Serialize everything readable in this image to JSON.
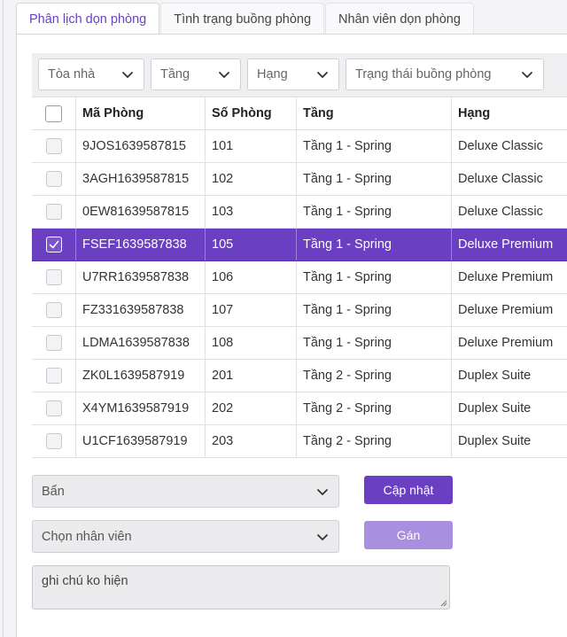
{
  "tabs": [
    {
      "label": "Phân lịch dọn phòng",
      "active": true
    },
    {
      "label": "Tình trạng buồng phòng",
      "active": false
    },
    {
      "label": "Nhân viên dọn phòng",
      "active": false
    }
  ],
  "filters": {
    "building": "Tòa nhà",
    "floor": "Tầng",
    "class": "Hạng",
    "room_status": "Trạng thái buồng phòng"
  },
  "table": {
    "columns": [
      "Mã Phòng",
      "Số Phòng",
      "Tầng",
      "Hạng"
    ],
    "rows": [
      {
        "code": "9JOS1639587815",
        "number": "101",
        "floor": "Tầng 1 - Spring",
        "class": "Deluxe Classic",
        "selected": false
      },
      {
        "code": "3AGH1639587815",
        "number": "102",
        "floor": "Tầng 1 - Spring",
        "class": "Deluxe Classic",
        "selected": false
      },
      {
        "code": "0EW81639587815",
        "number": "103",
        "floor": "Tầng 1 - Spring",
        "class": "Deluxe Classic",
        "selected": false
      },
      {
        "code": "FSEF1639587838",
        "number": "105",
        "floor": "Tầng 1 - Spring",
        "class": "Deluxe Premium",
        "selected": true
      },
      {
        "code": "U7RR1639587838",
        "number": "106",
        "floor": "Tầng 1 - Spring",
        "class": "Deluxe Premium",
        "selected": false
      },
      {
        "code": "FZ331639587838",
        "number": "107",
        "floor": "Tầng 1 - Spring",
        "class": "Deluxe Premium",
        "selected": false
      },
      {
        "code": "LDMA1639587838",
        "number": "108",
        "floor": "Tầng 1 - Spring",
        "class": "Deluxe Premium",
        "selected": false
      },
      {
        "code": "ZK0L1639587919",
        "number": "201",
        "floor": "Tầng 2 - Spring",
        "class": "Duplex Suite",
        "selected": false
      },
      {
        "code": "X4YM1639587919",
        "number": "202",
        "floor": "Tầng 2 - Spring",
        "class": "Duplex Suite",
        "selected": false
      },
      {
        "code": "U1CF1639587919",
        "number": "203",
        "floor": "Tầng 2 - Spring",
        "class": "Duplex Suite",
        "selected": false
      }
    ]
  },
  "actions": {
    "status_select": "Bẩn",
    "update_label": "Cập nhật",
    "staff_select": "Chọn nhân viên",
    "assign_label": "Gán"
  },
  "note": {
    "value": "ghi chú ko hiện"
  },
  "colors": {
    "accent": "#6a3fc1",
    "accent_disabled": "#a98fe0"
  }
}
